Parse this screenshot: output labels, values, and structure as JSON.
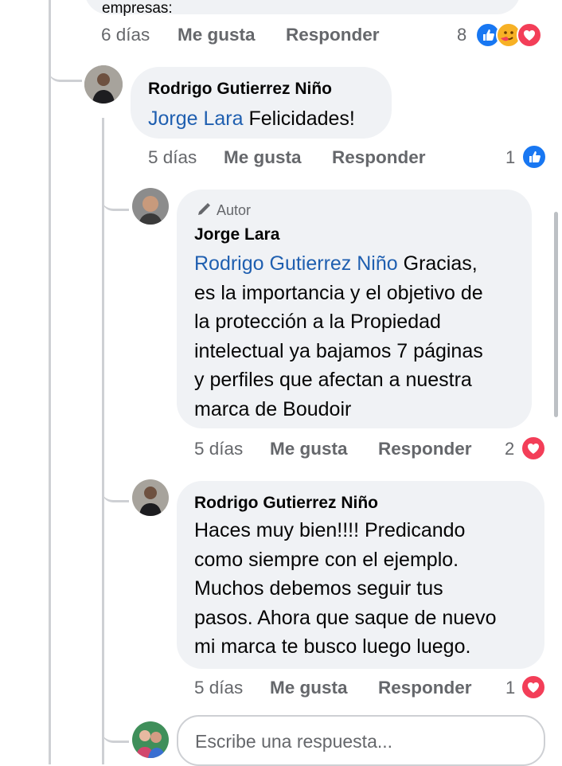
{
  "prev_comment": {
    "text_tail": "empresas:",
    "time": "6 días",
    "like": "Me gusta",
    "reply": "Responder",
    "reaction_count": "8",
    "reactions": [
      "like-icon",
      "care-icon",
      "love-icon"
    ]
  },
  "comments": [
    {
      "name": "Rodrigo Gutierrez Niño",
      "mention": "Jorge Lara",
      "text": " Felicidades!",
      "time": "5 días",
      "like": "Me gusta",
      "reply": "Responder",
      "reaction_count": "1",
      "reactions": [
        "like-icon"
      ]
    },
    {
      "badge": "Autor",
      "name": "Jorge Lara",
      "mention": "Rodrigo Gutierrez Niño",
      "text_lines": [
        " Gracias,",
        "es la importancia y el objetivo de",
        "la protección a la Propiedad",
        "intelectual ya bajamos 7 páginas",
        "y perfiles que afectan a nuestra",
        "marca de Boudoir"
      ],
      "time": "5 días",
      "like": "Me gusta",
      "reply": "Responder",
      "reaction_count": "2",
      "reactions": [
        "love-icon"
      ]
    },
    {
      "name": "Rodrigo Gutierrez Niño",
      "text_lines": [
        "Haces muy bien!!!! Predicando",
        "como siempre con el ejemplo.",
        "Muchos debemos seguir tus",
        "pasos. Ahora que saque de nuevo",
        "mi marca te busco luego luego."
      ],
      "time": "5 días",
      "like": "Me gusta",
      "reply": "Responder",
      "reaction_count": "1",
      "reactions": [
        "love-icon"
      ]
    }
  ],
  "reply_box": {
    "placeholder": "Escribe una respuesta..."
  },
  "colors": {
    "mention": "#1f5fb0",
    "like_blue": "#1877f2",
    "love_red": "#f33e58",
    "bubble": "#f0f2f5"
  }
}
